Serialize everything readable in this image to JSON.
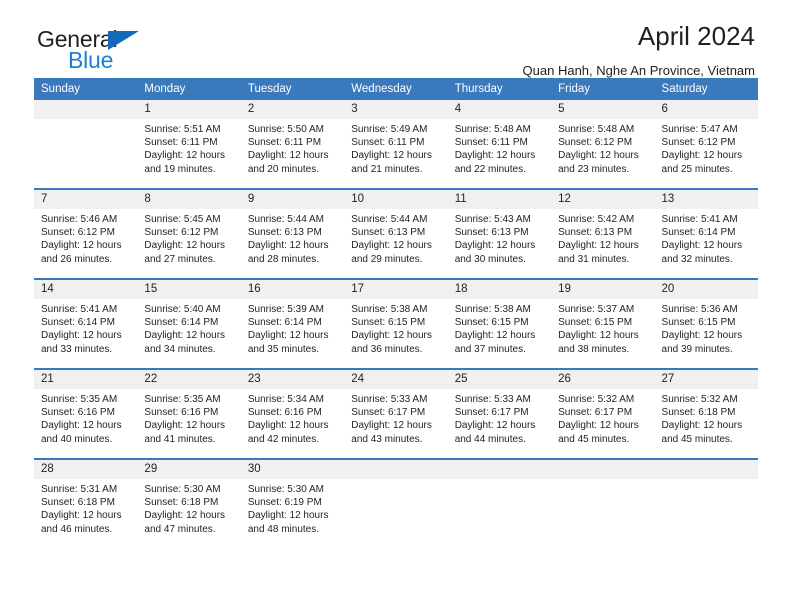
{
  "brand": {
    "logo_line1": "General",
    "logo_line2": "Blue",
    "triangle_icon": "blue-triangle-icon",
    "accent_color": "#1b7fd4"
  },
  "header": {
    "title": "April 2024",
    "subtitle": "Quan Hanh, Nghe An Province, Vietnam"
  },
  "colors": {
    "header_row_bg": "#3b79bd",
    "header_row_text": "#ffffff",
    "daynum_bg": "#f0f0f0",
    "week_border": "#3b79bd",
    "text": "#231f20"
  },
  "weekdays": [
    "Sunday",
    "Monday",
    "Tuesday",
    "Wednesday",
    "Thursday",
    "Friday",
    "Saturday"
  ],
  "labels": {
    "sunrise": "Sunrise:",
    "sunset": "Sunset:",
    "daylight": "Daylight:"
  },
  "weeks": [
    [
      {
        "day": "",
        "empty": true,
        "sunrise": "",
        "sunset": "",
        "daylight_line1": "",
        "daylight_line2": ""
      },
      {
        "day": "1",
        "sunrise": "Sunrise: 5:51 AM",
        "sunset": "Sunset: 6:11 PM",
        "daylight_line1": "Daylight: 12 hours",
        "daylight_line2": "and 19 minutes."
      },
      {
        "day": "2",
        "sunrise": "Sunrise: 5:50 AM",
        "sunset": "Sunset: 6:11 PM",
        "daylight_line1": "Daylight: 12 hours",
        "daylight_line2": "and 20 minutes."
      },
      {
        "day": "3",
        "sunrise": "Sunrise: 5:49 AM",
        "sunset": "Sunset: 6:11 PM",
        "daylight_line1": "Daylight: 12 hours",
        "daylight_line2": "and 21 minutes."
      },
      {
        "day": "4",
        "sunrise": "Sunrise: 5:48 AM",
        "sunset": "Sunset: 6:11 PM",
        "daylight_line1": "Daylight: 12 hours",
        "daylight_line2": "and 22 minutes."
      },
      {
        "day": "5",
        "sunrise": "Sunrise: 5:48 AM",
        "sunset": "Sunset: 6:12 PM",
        "daylight_line1": "Daylight: 12 hours",
        "daylight_line2": "and 23 minutes."
      },
      {
        "day": "6",
        "sunrise": "Sunrise: 5:47 AM",
        "sunset": "Sunset: 6:12 PM",
        "daylight_line1": "Daylight: 12 hours",
        "daylight_line2": "and 25 minutes."
      }
    ],
    [
      {
        "day": "7",
        "sunrise": "Sunrise: 5:46 AM",
        "sunset": "Sunset: 6:12 PM",
        "daylight_line1": "Daylight: 12 hours",
        "daylight_line2": "and 26 minutes."
      },
      {
        "day": "8",
        "sunrise": "Sunrise: 5:45 AM",
        "sunset": "Sunset: 6:12 PM",
        "daylight_line1": "Daylight: 12 hours",
        "daylight_line2": "and 27 minutes."
      },
      {
        "day": "9",
        "sunrise": "Sunrise: 5:44 AM",
        "sunset": "Sunset: 6:13 PM",
        "daylight_line1": "Daylight: 12 hours",
        "daylight_line2": "and 28 minutes."
      },
      {
        "day": "10",
        "sunrise": "Sunrise: 5:44 AM",
        "sunset": "Sunset: 6:13 PM",
        "daylight_line1": "Daylight: 12 hours",
        "daylight_line2": "and 29 minutes."
      },
      {
        "day": "11",
        "sunrise": "Sunrise: 5:43 AM",
        "sunset": "Sunset: 6:13 PM",
        "daylight_line1": "Daylight: 12 hours",
        "daylight_line2": "and 30 minutes."
      },
      {
        "day": "12",
        "sunrise": "Sunrise: 5:42 AM",
        "sunset": "Sunset: 6:13 PM",
        "daylight_line1": "Daylight: 12 hours",
        "daylight_line2": "and 31 minutes."
      },
      {
        "day": "13",
        "sunrise": "Sunrise: 5:41 AM",
        "sunset": "Sunset: 6:14 PM",
        "daylight_line1": "Daylight: 12 hours",
        "daylight_line2": "and 32 minutes."
      }
    ],
    [
      {
        "day": "14",
        "sunrise": "Sunrise: 5:41 AM",
        "sunset": "Sunset: 6:14 PM",
        "daylight_line1": "Daylight: 12 hours",
        "daylight_line2": "and 33 minutes."
      },
      {
        "day": "15",
        "sunrise": "Sunrise: 5:40 AM",
        "sunset": "Sunset: 6:14 PM",
        "daylight_line1": "Daylight: 12 hours",
        "daylight_line2": "and 34 minutes."
      },
      {
        "day": "16",
        "sunrise": "Sunrise: 5:39 AM",
        "sunset": "Sunset: 6:14 PM",
        "daylight_line1": "Daylight: 12 hours",
        "daylight_line2": "and 35 minutes."
      },
      {
        "day": "17",
        "sunrise": "Sunrise: 5:38 AM",
        "sunset": "Sunset: 6:15 PM",
        "daylight_line1": "Daylight: 12 hours",
        "daylight_line2": "and 36 minutes."
      },
      {
        "day": "18",
        "sunrise": "Sunrise: 5:38 AM",
        "sunset": "Sunset: 6:15 PM",
        "daylight_line1": "Daylight: 12 hours",
        "daylight_line2": "and 37 minutes."
      },
      {
        "day": "19",
        "sunrise": "Sunrise: 5:37 AM",
        "sunset": "Sunset: 6:15 PM",
        "daylight_line1": "Daylight: 12 hours",
        "daylight_line2": "and 38 minutes."
      },
      {
        "day": "20",
        "sunrise": "Sunrise: 5:36 AM",
        "sunset": "Sunset: 6:15 PM",
        "daylight_line1": "Daylight: 12 hours",
        "daylight_line2": "and 39 minutes."
      }
    ],
    [
      {
        "day": "21",
        "sunrise": "Sunrise: 5:35 AM",
        "sunset": "Sunset: 6:16 PM",
        "daylight_line1": "Daylight: 12 hours",
        "daylight_line2": "and 40 minutes."
      },
      {
        "day": "22",
        "sunrise": "Sunrise: 5:35 AM",
        "sunset": "Sunset: 6:16 PM",
        "daylight_line1": "Daylight: 12 hours",
        "daylight_line2": "and 41 minutes."
      },
      {
        "day": "23",
        "sunrise": "Sunrise: 5:34 AM",
        "sunset": "Sunset: 6:16 PM",
        "daylight_line1": "Daylight: 12 hours",
        "daylight_line2": "and 42 minutes."
      },
      {
        "day": "24",
        "sunrise": "Sunrise: 5:33 AM",
        "sunset": "Sunset: 6:17 PM",
        "daylight_line1": "Daylight: 12 hours",
        "daylight_line2": "and 43 minutes."
      },
      {
        "day": "25",
        "sunrise": "Sunrise: 5:33 AM",
        "sunset": "Sunset: 6:17 PM",
        "daylight_line1": "Daylight: 12 hours",
        "daylight_line2": "and 44 minutes."
      },
      {
        "day": "26",
        "sunrise": "Sunrise: 5:32 AM",
        "sunset": "Sunset: 6:17 PM",
        "daylight_line1": "Daylight: 12 hours",
        "daylight_line2": "and 45 minutes."
      },
      {
        "day": "27",
        "sunrise": "Sunrise: 5:32 AM",
        "sunset": "Sunset: 6:18 PM",
        "daylight_line1": "Daylight: 12 hours",
        "daylight_line2": "and 45 minutes."
      }
    ],
    [
      {
        "day": "28",
        "sunrise": "Sunrise: 5:31 AM",
        "sunset": "Sunset: 6:18 PM",
        "daylight_line1": "Daylight: 12 hours",
        "daylight_line2": "and 46 minutes."
      },
      {
        "day": "29",
        "sunrise": "Sunrise: 5:30 AM",
        "sunset": "Sunset: 6:18 PM",
        "daylight_line1": "Daylight: 12 hours",
        "daylight_line2": "and 47 minutes."
      },
      {
        "day": "30",
        "sunrise": "Sunrise: 5:30 AM",
        "sunset": "Sunset: 6:19 PM",
        "daylight_line1": "Daylight: 12 hours",
        "daylight_line2": "and 48 minutes."
      },
      {
        "day": "",
        "empty": true,
        "sunrise": "",
        "sunset": "",
        "daylight_line1": "",
        "daylight_line2": ""
      },
      {
        "day": "",
        "empty": true,
        "sunrise": "",
        "sunset": "",
        "daylight_line1": "",
        "daylight_line2": ""
      },
      {
        "day": "",
        "empty": true,
        "sunrise": "",
        "sunset": "",
        "daylight_line1": "",
        "daylight_line2": ""
      },
      {
        "day": "",
        "empty": true,
        "sunrise": "",
        "sunset": "",
        "daylight_line1": "",
        "daylight_line2": ""
      }
    ]
  ]
}
